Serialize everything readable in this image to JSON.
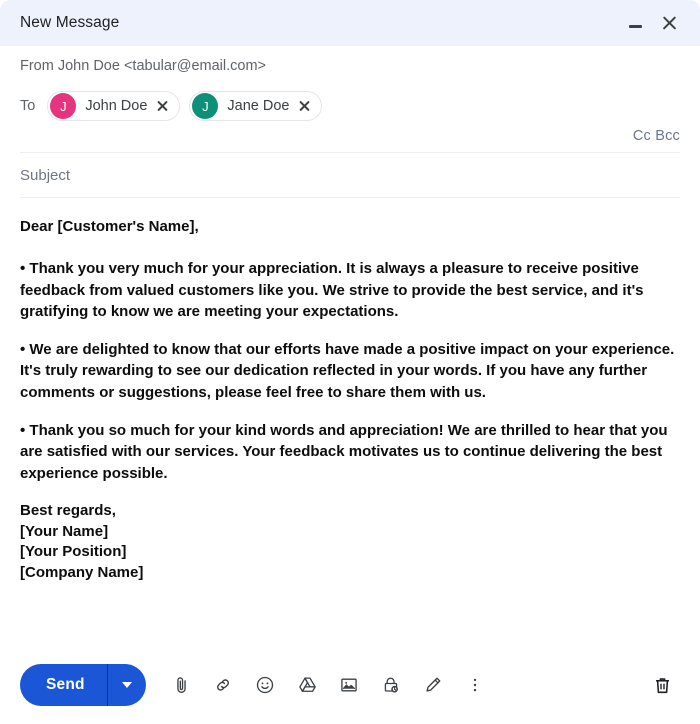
{
  "window": {
    "title": "New Message",
    "minimize_label": "Minimize",
    "close_label": "Close"
  },
  "header": {
    "from_line": "From John Doe <tabular@email.com>",
    "to_label": "To",
    "recipients": [
      {
        "name": "John Doe",
        "initial": "J",
        "avatar_color": "#e5357f",
        "remove_label": "Remove"
      },
      {
        "name": "Jane Doe",
        "initial": "J",
        "avatar_color": "#0d8f7a",
        "remove_label": "Remove"
      }
    ],
    "cc_bcc_label": "Cc Bcc",
    "subject_placeholder": "Subject"
  },
  "body": {
    "salutation": "Dear [Customer's Name],",
    "paragraphs": [
      "• Thank you very much for your appreciation. It is always a pleasure to receive positive feedback from valued customers like you. We strive to provide the best service, and it's gratifying to know we are meeting your expectations.",
      "• We are delighted to know that our efforts have made a positive impact on your experience. It's truly rewarding to see our dedication reflected in your words. If you have any further comments or suggestions, please feel free to share them with us.",
      "• Thank you so much for your kind words and appreciation! We are thrilled to hear that you are satisfied with our services. Your feedback motivates us to continue delivering the best experience possible."
    ],
    "signature_lines": [
      "Best regards,",
      "[Your Name]",
      "[Your Position]",
      "[Company Name]"
    ]
  },
  "toolbar": {
    "send_label": "Send",
    "send_options_label": "More send options",
    "accent_color": "#1a56d6",
    "icons": [
      {
        "name": "attach-file-icon",
        "label": "Attach files"
      },
      {
        "name": "insert-link-icon",
        "label": "Insert link"
      },
      {
        "name": "insert-emoji-icon",
        "label": "Insert emoji"
      },
      {
        "name": "google-drive-icon",
        "label": "Insert files using Drive"
      },
      {
        "name": "insert-photo-icon",
        "label": "Insert photo"
      },
      {
        "name": "confidential-mode-icon",
        "label": "Toggle confidential mode"
      },
      {
        "name": "insert-signature-icon",
        "label": "Insert signature"
      },
      {
        "name": "more-options-icon",
        "label": "More options"
      }
    ],
    "discard_label": "Discard draft"
  }
}
